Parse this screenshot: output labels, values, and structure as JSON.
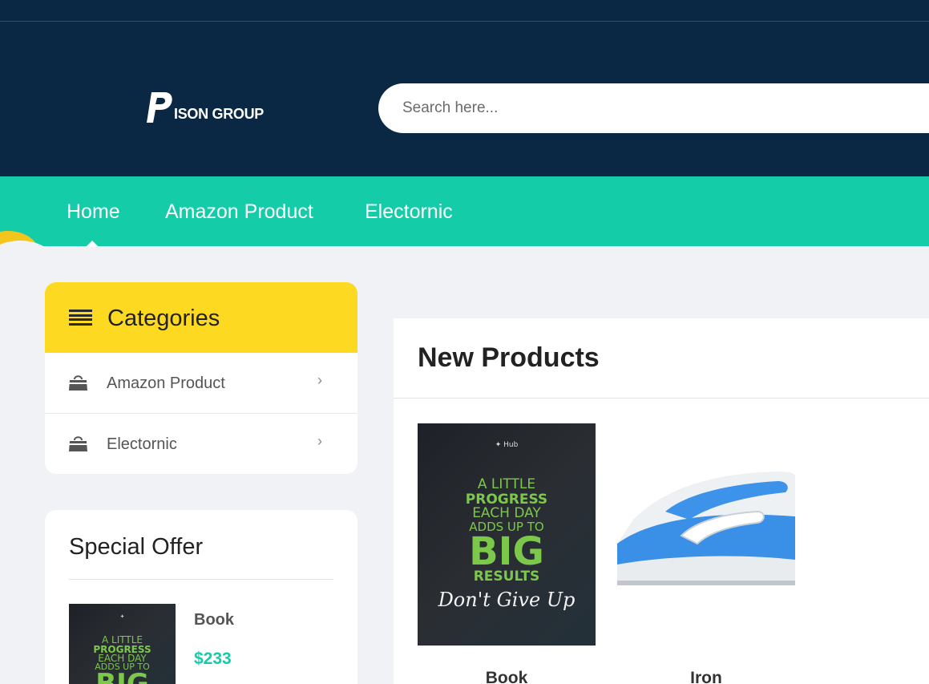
{
  "header": {
    "logo_text": "ISON GROUP",
    "search_placeholder": "Search here..."
  },
  "nav": {
    "items": [
      {
        "label": "Home"
      },
      {
        "label": "Amazon Product"
      },
      {
        "label": "Electornic"
      }
    ]
  },
  "categories": {
    "title": "Categories",
    "items": [
      {
        "label": "Amazon Product"
      },
      {
        "label": "Electornic"
      }
    ]
  },
  "special_offer": {
    "title": "Special Offer",
    "product": {
      "name": "Book",
      "price": "$233"
    }
  },
  "new_products": {
    "title": "New Products",
    "items": [
      {
        "name": "Book"
      },
      {
        "name": "Iron"
      }
    ]
  },
  "poster": {
    "line1": "A LITTLE",
    "line2": "PROGRESS",
    "line3": "EACH DAY",
    "line4": "ADDS UP TO",
    "line5": "BIG",
    "line6": "RESULTS",
    "line7": "Don't Give Up"
  },
  "colors": {
    "header_bg": "#0a2744",
    "nav_bg": "#14cca8",
    "categories_head": "#fdd922",
    "price": "#14cca8"
  }
}
